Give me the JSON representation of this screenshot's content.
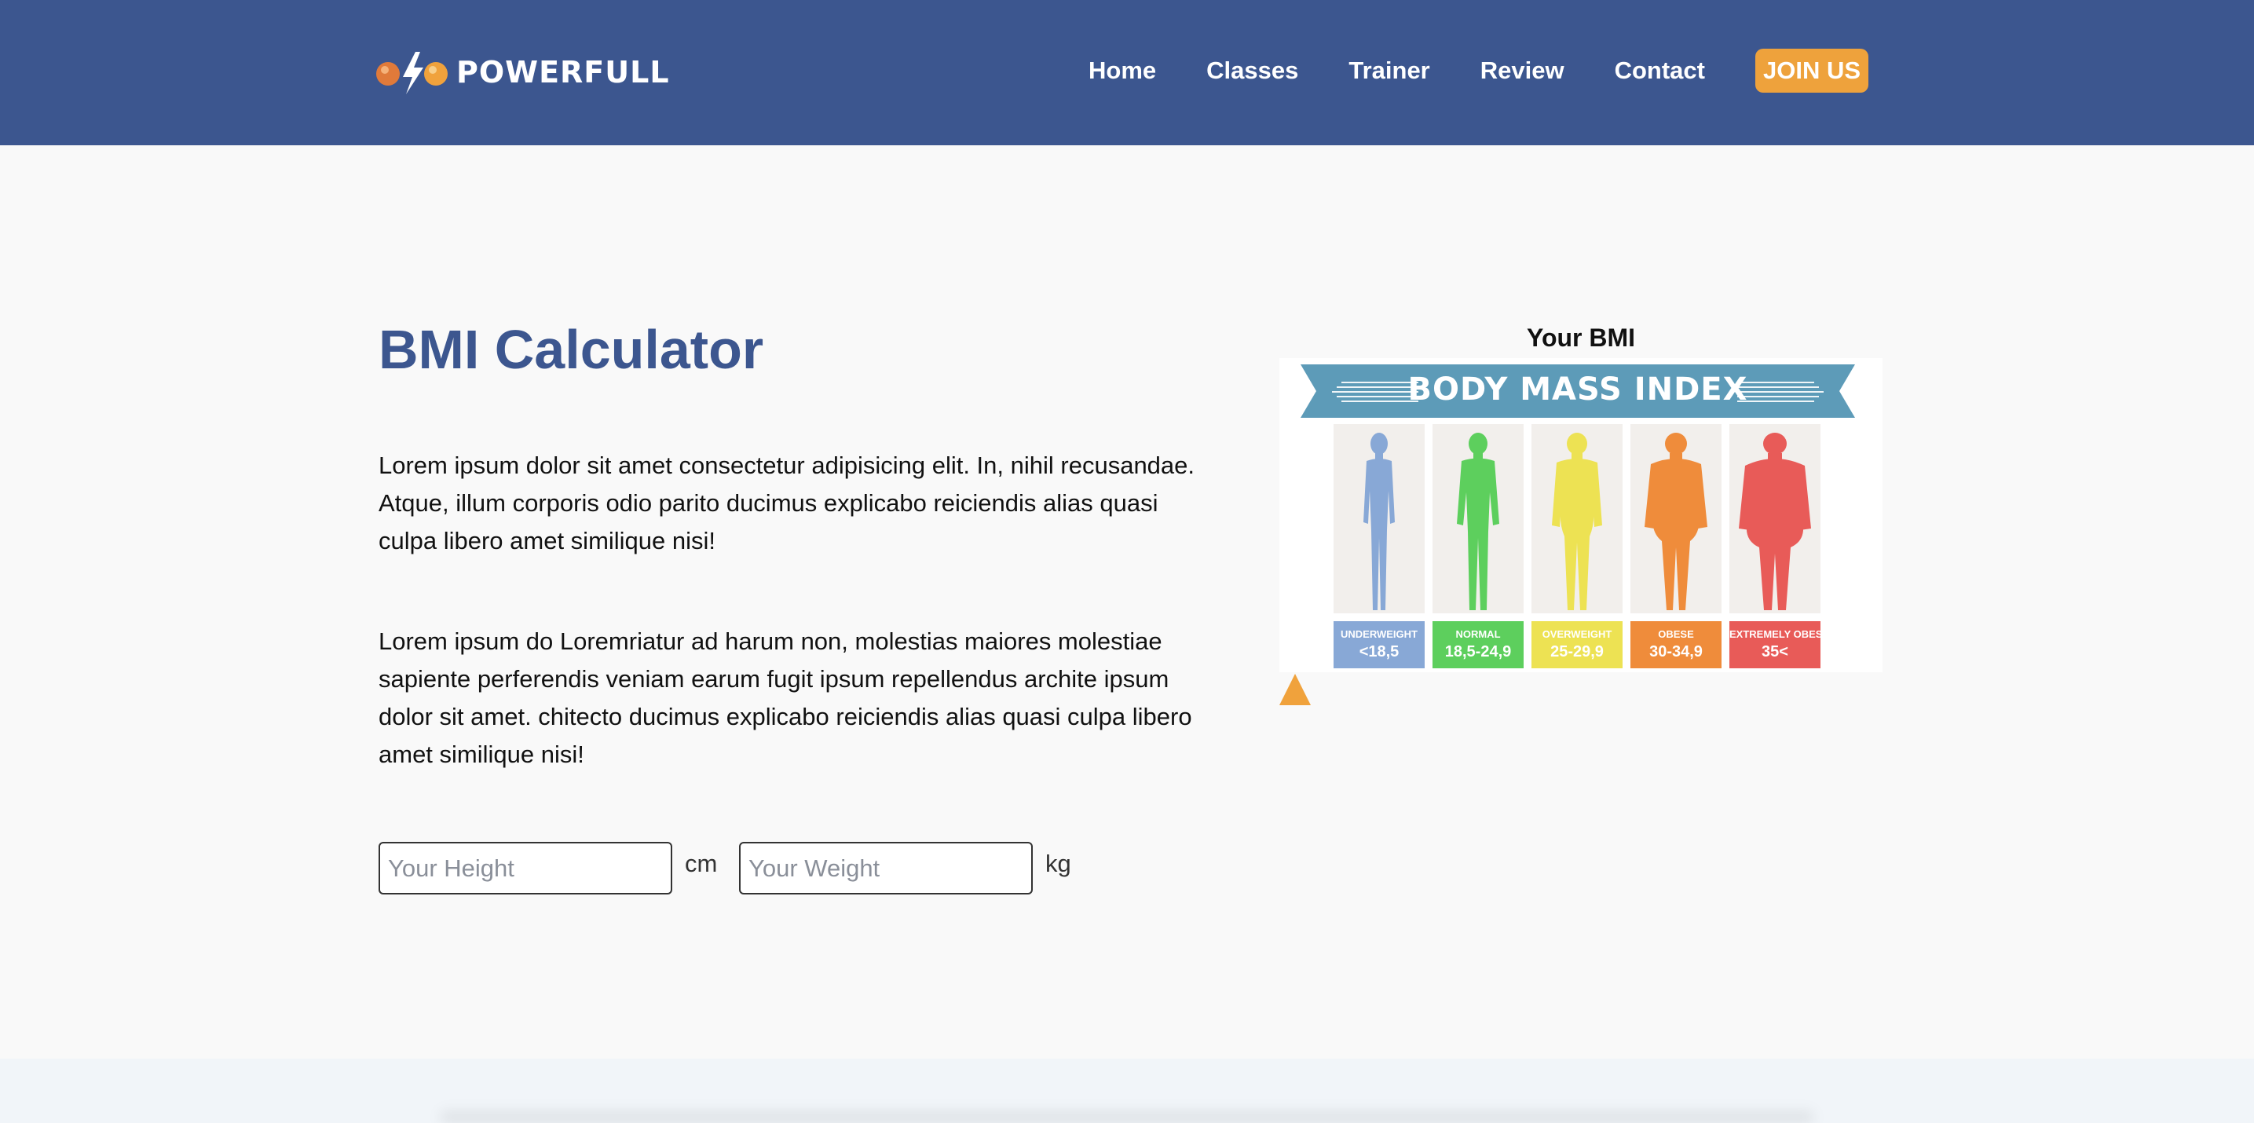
{
  "brand": {
    "name": "POWERFULL"
  },
  "nav": {
    "items": [
      {
        "label": "Home"
      },
      {
        "label": "Classes"
      },
      {
        "label": "Trainer"
      },
      {
        "label": "Review"
      },
      {
        "label": "Contact"
      }
    ],
    "cta_label": "JOIN US"
  },
  "main": {
    "title": "BMI Calculator",
    "paragraph1": "Lorem ipsum dolor sit amet consectetur adipisicing elit. In, nihil recusandae. Atque, illum corporis odio parito ducimus explicabo reiciendis alias quasi culpa libero amet similique nisi!",
    "paragraph2": "Lorem ipsum do Loremriatur ad harum non, molestias maiores molestiae sapiente perferendis veniam earum fugit ipsum repellendus archite ipsum dolor sit amet. chitecto ducimus explicabo reiciendis alias quasi culpa libero amet similique nisi!",
    "height_placeholder": "Your Height",
    "height_unit": "cm",
    "weight_placeholder": "Your Weight",
    "weight_unit": "kg"
  },
  "bmi": {
    "label": "Your BMI",
    "banner": "BODY MASS INDEX",
    "categories": [
      {
        "name": "UNDERWEIGHT",
        "range": "<18,5",
        "color": "#88a8d6"
      },
      {
        "name": "NORMAL",
        "range": "18,5-24,9",
        "color": "#5dcf5d"
      },
      {
        "name": "OVERWEIGHT",
        "range": "25-29,9",
        "color": "#ede253"
      },
      {
        "name": "OBESE",
        "range": "30-34,9",
        "color": "#ef8c3b"
      },
      {
        "name": "EXTREMELY OBESE",
        "range": "35<",
        "color": "#e85b58"
      }
    ]
  },
  "colors": {
    "header_bg": "#3c568f",
    "accent": "#eea23c",
    "title": "#3c568f",
    "banner": "#5d9bb8"
  }
}
